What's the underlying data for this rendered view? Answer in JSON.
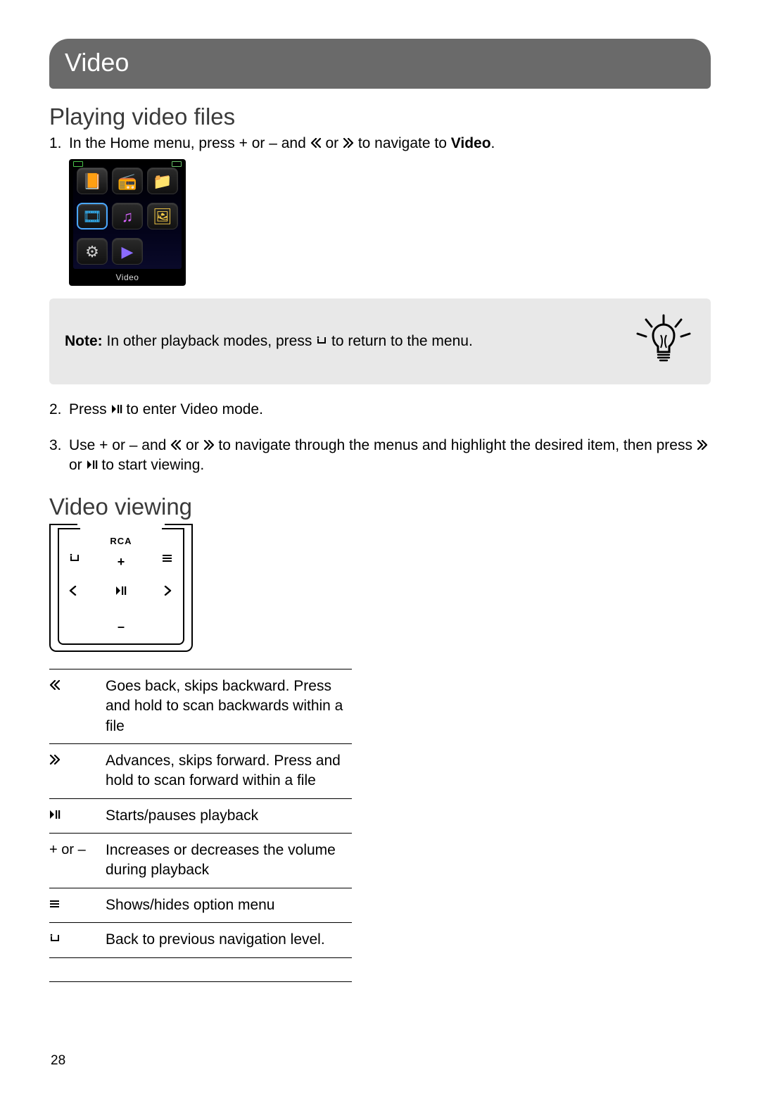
{
  "chapter_title": "Video",
  "section_playing": "Playing video files",
  "step1_prefix": "In the Home menu, press + or – and ",
  "step1_mid": " or ",
  "step1_suffix_a": " to navigate to ",
  "step1_bold": "Video",
  "step1_end": ".",
  "device_label": "Video",
  "note_label": "Note:",
  "note_text": " In other playback modes, press ",
  "note_text_after": " to return to the menu.",
  "step2_a": "Press ",
  "step2_b": " to enter Video mode.",
  "step3_a": "Use + or – and ",
  "step3_or": " or ",
  "step3_b": " to navigate through the menus and highlight the desired item, then press ",
  "step3_or2": " or ",
  "step3_c": " to start viewing.",
  "section_viewing": "Video viewing",
  "pad_brand": "RCA",
  "pad_plus": "+",
  "pad_minus": "–",
  "controls": [
    {
      "key_icon": "dbl-left",
      "desc": "Goes back, skips backward. Press and hold to scan backwards within a file"
    },
    {
      "key_icon": "dbl-right",
      "desc": "Advances, skips forward. Press and hold to scan forward within a file"
    },
    {
      "key_icon": "playpause",
      "desc": "Starts/pauses playback"
    },
    {
      "key_text": "+ or –",
      "desc": "Increases or decreases the volume during playback"
    },
    {
      "key_icon": "menu",
      "desc": "Shows/hides option menu"
    },
    {
      "key_icon": "back",
      "desc": "Back to previous navigation level."
    }
  ],
  "page_number": "28"
}
